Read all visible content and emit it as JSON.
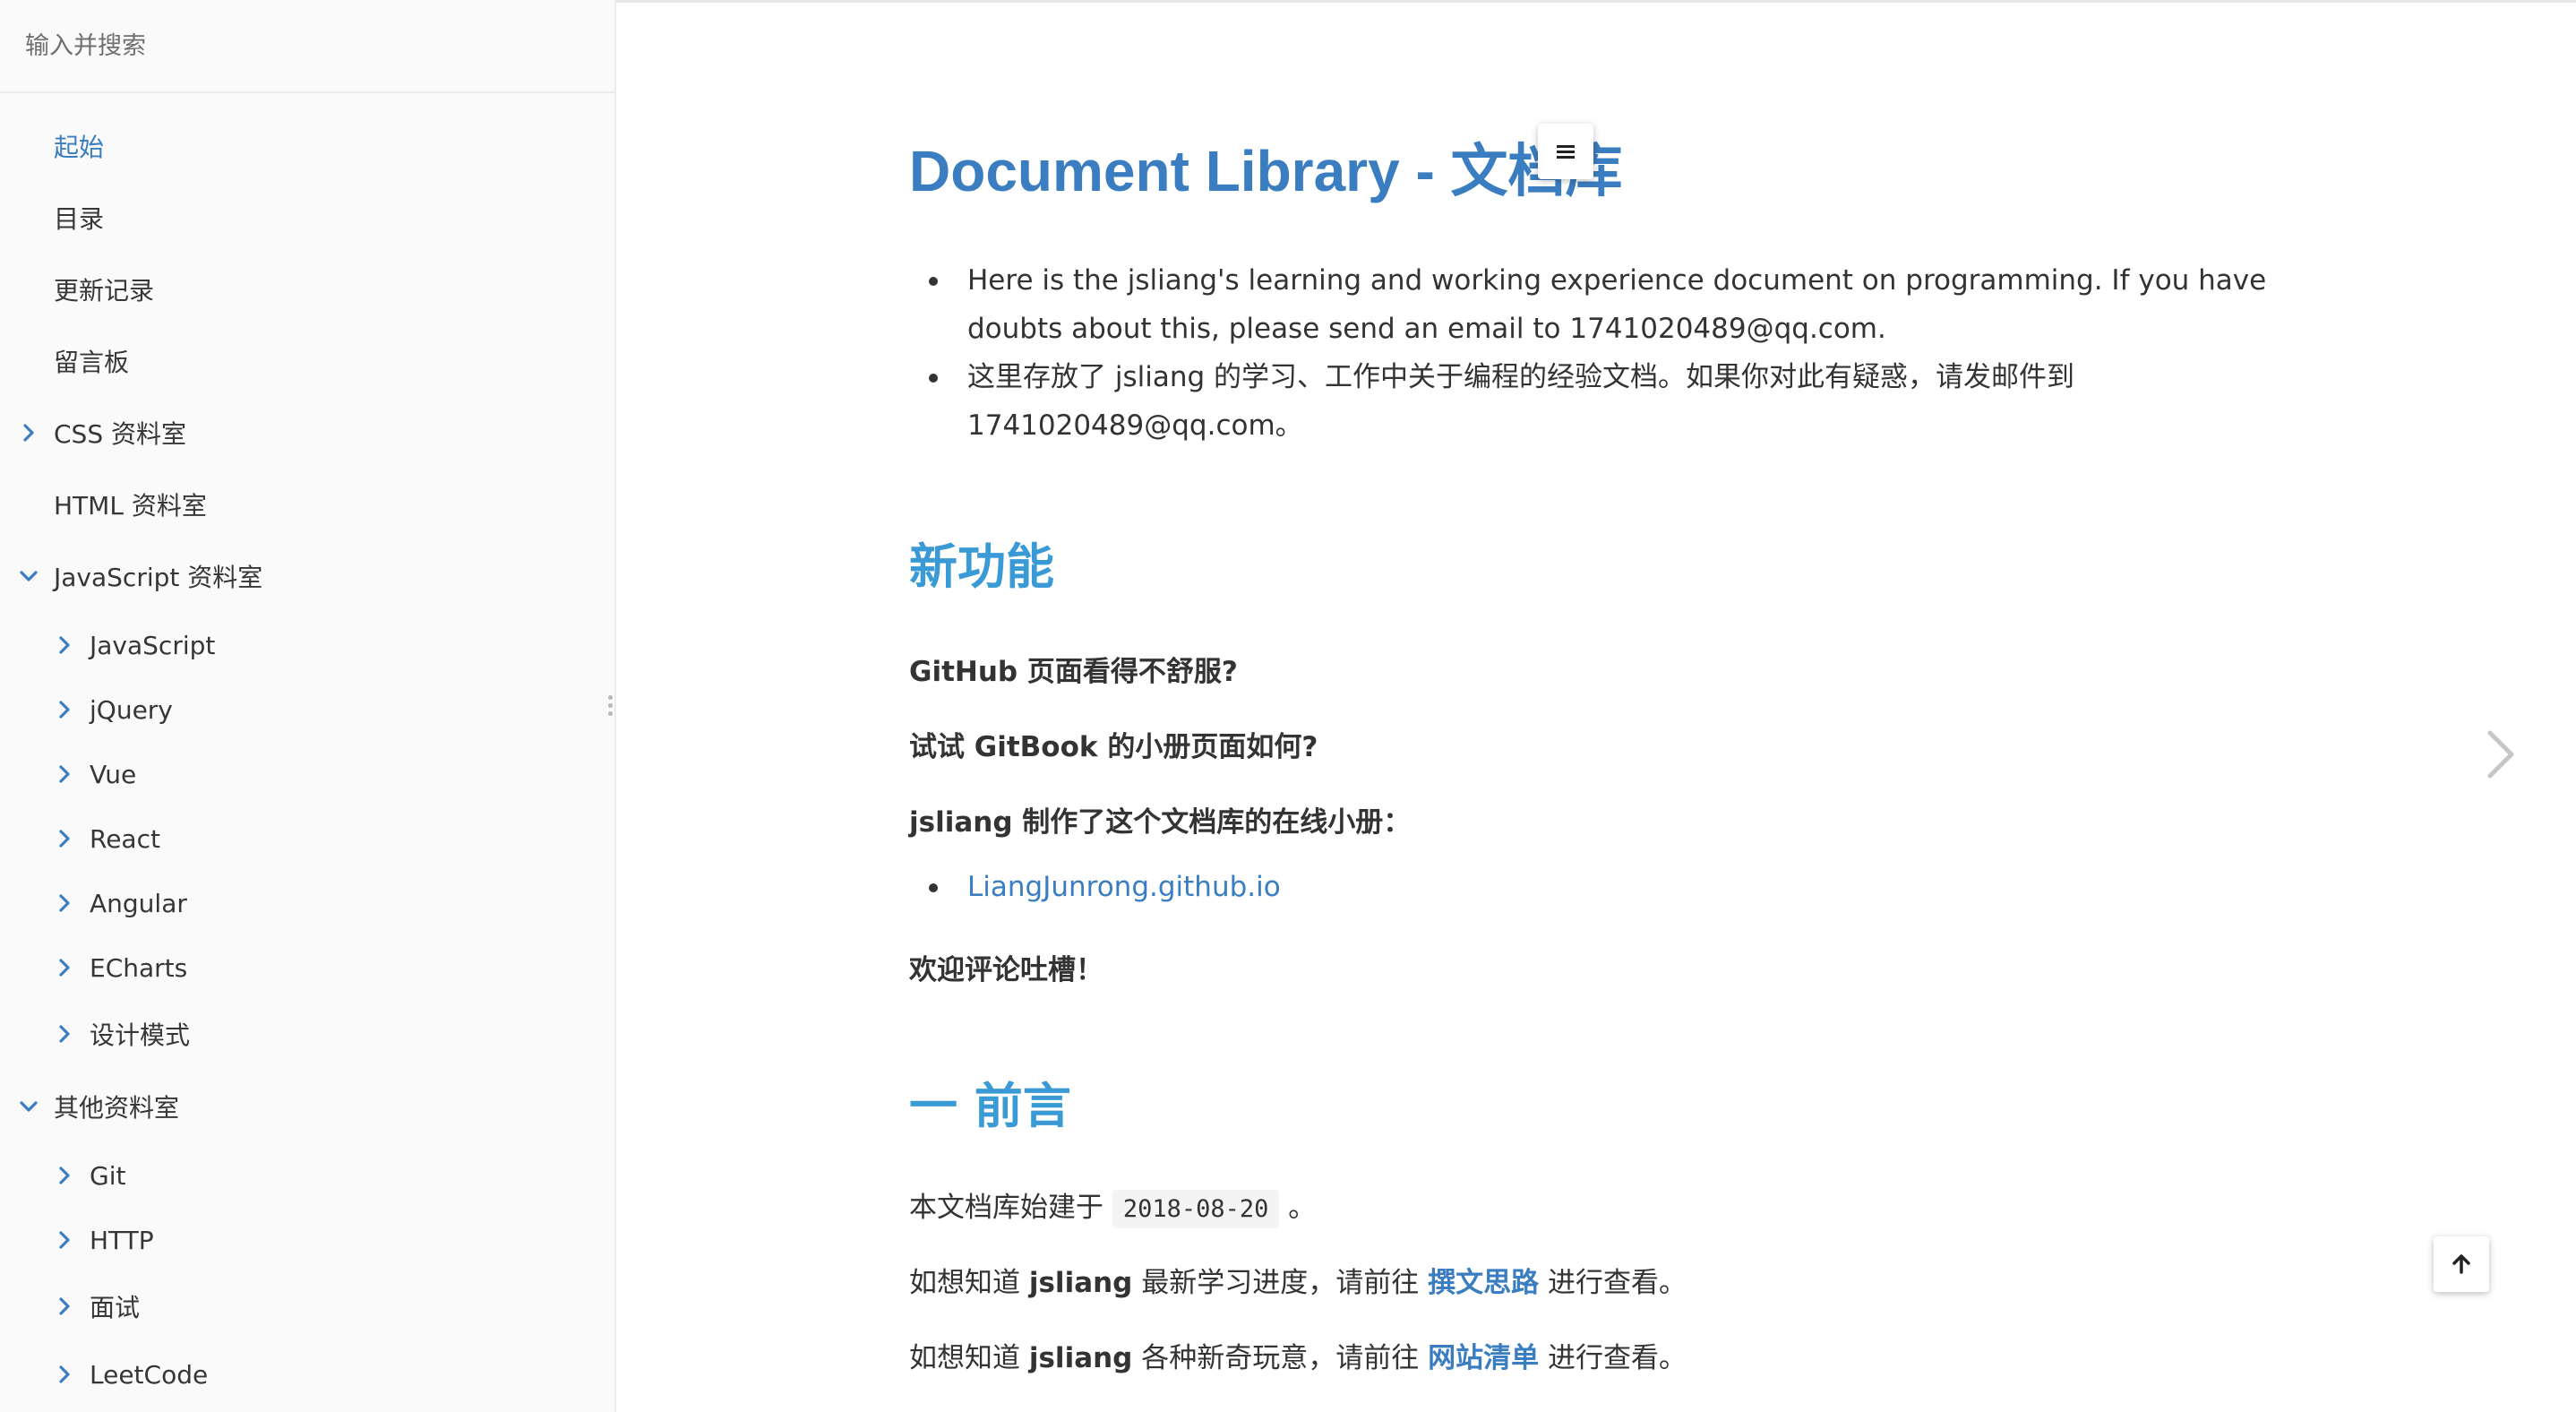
{
  "sidebar": {
    "search_placeholder": "输入并搜索",
    "items": [
      {
        "label": "起始"
      },
      {
        "label": "目录"
      },
      {
        "label": "更新记录"
      },
      {
        "label": "留言板"
      },
      {
        "label": "CSS 资料室"
      },
      {
        "label": "HTML 资料室"
      },
      {
        "label": "JavaScript 资料室"
      },
      {
        "label": "JavaScript"
      },
      {
        "label": "jQuery"
      },
      {
        "label": "Vue"
      },
      {
        "label": "React"
      },
      {
        "label": "Angular"
      },
      {
        "label": "ECharts"
      },
      {
        "label": "设计模式"
      },
      {
        "label": "其他资料室"
      },
      {
        "label": "Git"
      },
      {
        "label": "HTTP"
      },
      {
        "label": "面试"
      },
      {
        "label": "LeetCode"
      }
    ]
  },
  "main": {
    "title": "Document Library - 文档库",
    "intro": [
      "Here is the jsliang's learning and working experience document on programming. If you have doubts about this, please send an email to 1741020489@qq.com.",
      "这里存放了 jsliang 的学习、工作中关于编程的经验文档。如果你对此有疑惑，请发邮件到 1741020489@qq.com。"
    ],
    "section_features": {
      "heading": "新功能",
      "p1": "GitHub 页面看得不舒服?",
      "p2": "试试 GitBook 的小册页面如何?",
      "p3": "jsliang 制作了这个文档库的在线小册：",
      "link": "LiangJunrong.github.io",
      "p4": "欢迎评论吐槽！"
    },
    "section_preface": {
      "heading": "一 前言",
      "line1_prefix": "本文档库始建于",
      "line1_date": "2018-08-20",
      "line1_suffix": "。",
      "line2_prefix": "如想知道",
      "line2_name": "jsliang",
      "line2_mid": "最新学习进度，请前往",
      "line2_link": "撰文思路",
      "line2_suffix": "进行查看。",
      "line3_prefix": "如想知道",
      "line3_name": "jsliang",
      "line3_mid": "各种新奇玩意，请前往",
      "line3_link": "网站清单",
      "line3_suffix": "进行查看。"
    }
  },
  "colors": {
    "accent": "#3a7dc0",
    "heading2": "#3a9ad6",
    "sidebar_bg": "#fafafa"
  }
}
